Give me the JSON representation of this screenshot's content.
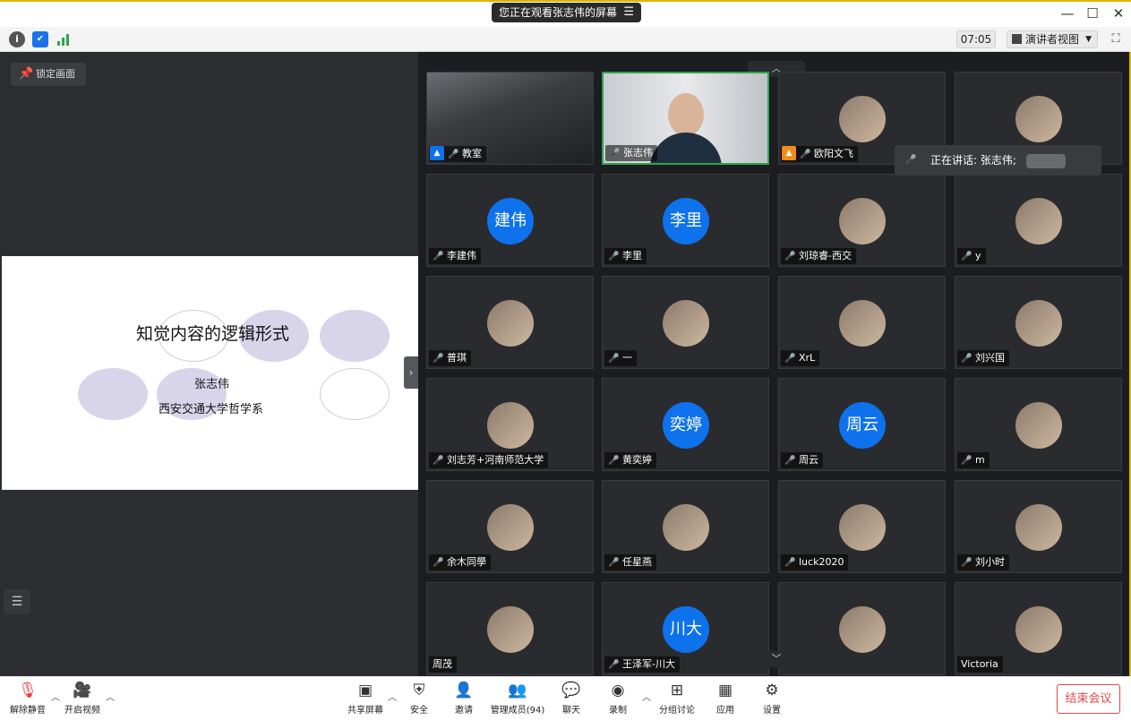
{
  "banner": {
    "text": "您正在观看张志伟的屏幕"
  },
  "infobar": {
    "timer": "07:05",
    "view_label": "演讲者视图"
  },
  "left": {
    "lock_label": "锁定画面",
    "slide": {
      "title": "知觉内容的逻辑形式",
      "name": "张志伟",
      "dept": "西安交通大学哲学系"
    }
  },
  "speaking": {
    "text": "正在讲话: 张志伟;"
  },
  "tiles": [
    {
      "name": "教室",
      "kind": "video-room",
      "role": "blue"
    },
    {
      "name": "张志伟",
      "kind": "video-person",
      "mic_on": true,
      "active": true
    },
    {
      "name": "欧阳文飞",
      "kind": "img",
      "role": "orange"
    },
    {
      "name": "",
      "kind": "img"
    },
    {
      "name": "李建伟",
      "kind": "text",
      "avatar": "建伟"
    },
    {
      "name": "李里",
      "kind": "text",
      "avatar": "李里"
    },
    {
      "name": "刘琼睿-西交",
      "kind": "img"
    },
    {
      "name": "y",
      "kind": "img"
    },
    {
      "name": "普琪",
      "kind": "img"
    },
    {
      "name": "一",
      "kind": "img"
    },
    {
      "name": "XrL",
      "kind": "img"
    },
    {
      "name": "刘兴国",
      "kind": "img"
    },
    {
      "name": "刘志芳+河南师范大学",
      "kind": "img"
    },
    {
      "name": "黄奕婷",
      "kind": "text",
      "avatar": "奕婷"
    },
    {
      "name": "周云",
      "kind": "text",
      "avatar": "周云"
    },
    {
      "name": "m",
      "kind": "img"
    },
    {
      "name": "余木同學",
      "kind": "img"
    },
    {
      "name": "任星燕",
      "kind": "img"
    },
    {
      "name": "luck2020",
      "kind": "img"
    },
    {
      "name": "刘小时",
      "kind": "img"
    },
    {
      "name": "周茂",
      "kind": "img",
      "no_mic": true
    },
    {
      "name": "王泽军-川大",
      "kind": "text",
      "avatar": "川大"
    },
    {
      "name": "",
      "kind": "img"
    },
    {
      "name": "Victoria",
      "kind": "img",
      "no_mic": true
    }
  ],
  "toolbar": {
    "mute": "解除静音",
    "video": "开启视频",
    "share": "共享屏幕",
    "security": "安全",
    "invite": "邀请",
    "members": "管理成员(94)",
    "chat": "聊天",
    "record": "录制",
    "breakout": "分组讨论",
    "apps": "应用",
    "settings": "设置",
    "end": "结束会议"
  },
  "colors": {
    "accent": "#0e72ed",
    "end": "#e54848",
    "active": "#2ea44f",
    "window_border": "#d9b800"
  }
}
